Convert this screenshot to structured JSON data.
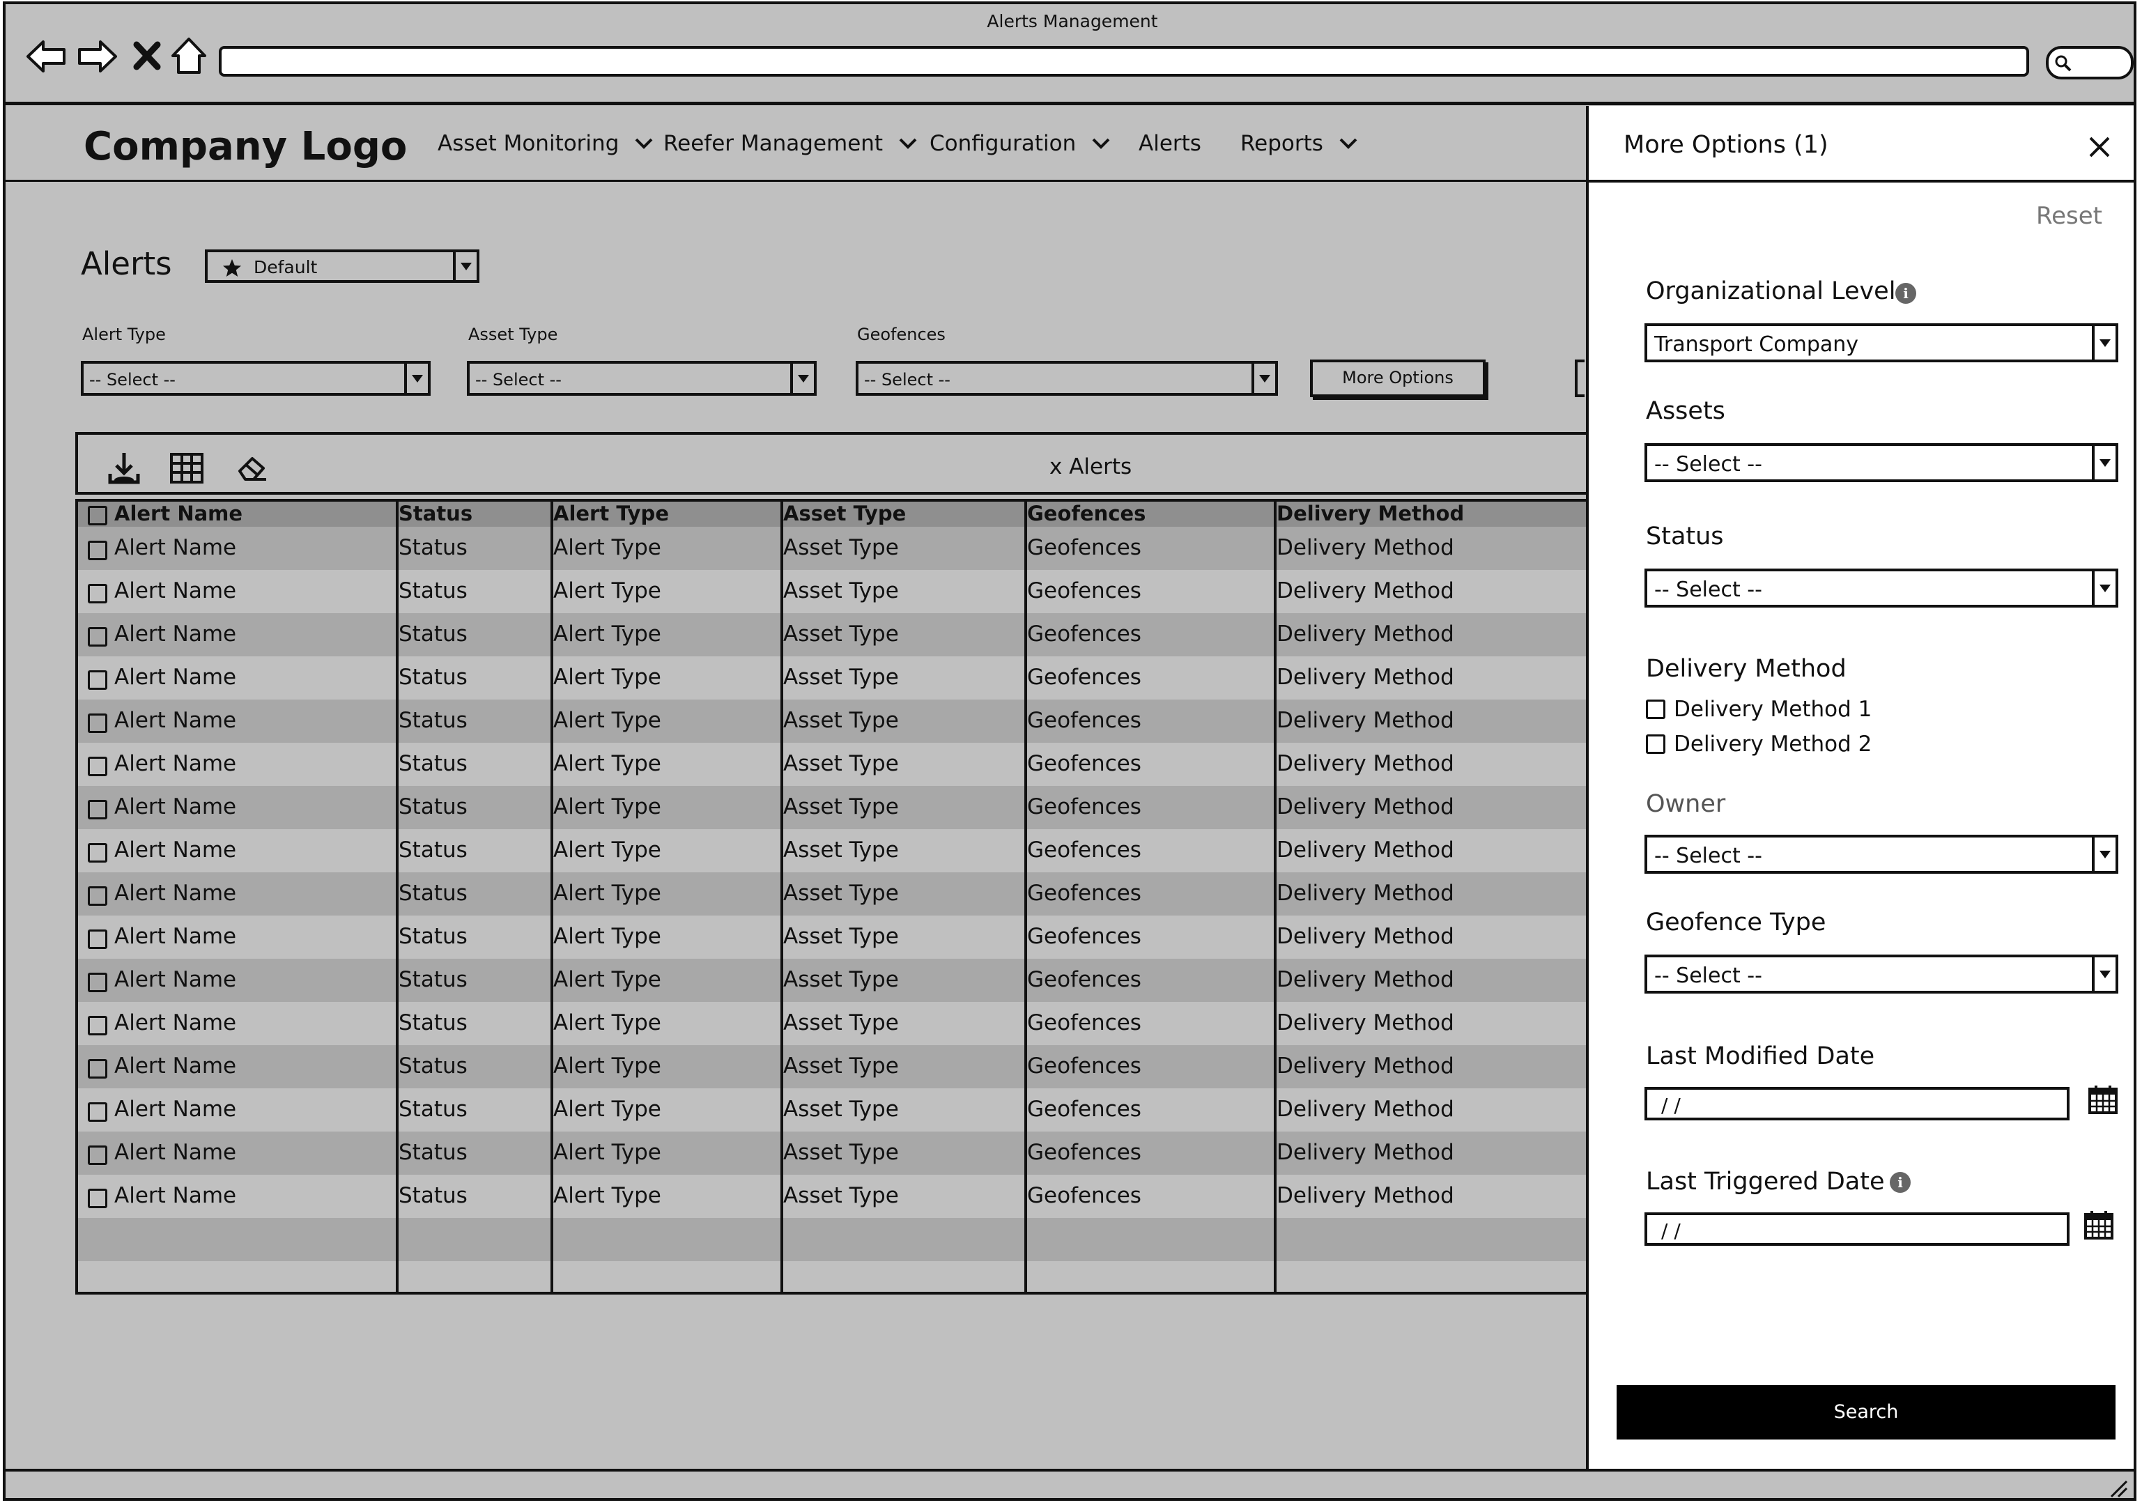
{
  "browser": {
    "title": "Alerts Management",
    "url": ""
  },
  "header": {
    "logo": "Company Logo",
    "nav": [
      {
        "label": "Asset Monitoring",
        "has_dropdown": true
      },
      {
        "label": "Reefer Management",
        "has_dropdown": true
      },
      {
        "label": "Configuration",
        "has_dropdown": true
      },
      {
        "label": "Alerts",
        "has_dropdown": false
      },
      {
        "label": "Reports",
        "has_dropdown": true
      }
    ]
  },
  "page": {
    "title": "Alerts",
    "saved_view": {
      "value": "Default",
      "icon": "star-icon"
    }
  },
  "filters": [
    {
      "label": "Alert Type",
      "value": "-- Select --"
    },
    {
      "label": "Asset Type",
      "value": "-- Select --"
    },
    {
      "label": "Geofences",
      "value": "-- Select --"
    }
  ],
  "more_options_button": "More Options",
  "toolbar": {
    "icons": [
      "download-icon",
      "grid-icon",
      "eraser-icon"
    ],
    "count_text": "x Alerts"
  },
  "table": {
    "columns": [
      "Alert Name",
      "Status",
      "Alert Type",
      "Asset Type",
      "Geofences",
      "Delivery Method"
    ],
    "rows": [
      [
        "Alert Name",
        "Status",
        "Alert Type",
        "Asset Type",
        "Geofences",
        "Delivery Method"
      ],
      [
        "Alert Name",
        "Status",
        "Alert Type",
        "Asset Type",
        "Geofences",
        "Delivery Method"
      ],
      [
        "Alert Name",
        "Status",
        "Alert Type",
        "Asset Type",
        "Geofences",
        "Delivery Method"
      ],
      [
        "Alert Name",
        "Status",
        "Alert Type",
        "Asset Type",
        "Geofences",
        "Delivery Method"
      ],
      [
        "Alert Name",
        "Status",
        "Alert Type",
        "Asset Type",
        "Geofences",
        "Delivery Method"
      ],
      [
        "Alert Name",
        "Status",
        "Alert Type",
        "Asset Type",
        "Geofences",
        "Delivery Method"
      ],
      [
        "Alert Name",
        "Status",
        "Alert Type",
        "Asset Type",
        "Geofences",
        "Delivery Method"
      ],
      [
        "Alert Name",
        "Status",
        "Alert Type",
        "Asset Type",
        "Geofences",
        "Delivery Method"
      ],
      [
        "Alert Name",
        "Status",
        "Alert Type",
        "Asset Type",
        "Geofences",
        "Delivery Method"
      ],
      [
        "Alert Name",
        "Status",
        "Alert Type",
        "Asset Type",
        "Geofences",
        "Delivery Method"
      ],
      [
        "Alert Name",
        "Status",
        "Alert Type",
        "Asset Type",
        "Geofences",
        "Delivery Method"
      ],
      [
        "Alert Name",
        "Status",
        "Alert Type",
        "Asset Type",
        "Geofences",
        "Delivery Method"
      ],
      [
        "Alert Name",
        "Status",
        "Alert Type",
        "Asset Type",
        "Geofences",
        "Delivery Method"
      ],
      [
        "Alert Name",
        "Status",
        "Alert Type",
        "Asset Type",
        "Geofences",
        "Delivery Method"
      ],
      [
        "Alert Name",
        "Status",
        "Alert Type",
        "Asset Type",
        "Geofences",
        "Delivery Method"
      ],
      [
        "Alert Name",
        "Status",
        "Alert Type",
        "Asset Type",
        "Geofences",
        "Delivery Method"
      ]
    ]
  },
  "panel": {
    "title": "More Options (1)",
    "reset": "Reset",
    "org_level": {
      "label": "Organizational Level",
      "value": "Transport Company"
    },
    "assets": {
      "label": "Assets",
      "value": "-- Select --"
    },
    "status": {
      "label": "Status",
      "value": "-- Select --"
    },
    "delivery_method": {
      "label": "Delivery Method",
      "options": [
        "Delivery Method 1",
        "Delivery Method 2"
      ]
    },
    "owner": {
      "label": "Owner",
      "value": "-- Select --"
    },
    "geofence_type": {
      "label": "Geofence Type",
      "value": "-- Select --"
    },
    "last_modified": {
      "label": "Last Modified Date",
      "value": "/ /"
    },
    "last_triggered": {
      "label": "Last Triggered Date",
      "value": "/ /"
    },
    "search": "Search"
  },
  "colors": {
    "background": "#c0c0c0",
    "panel": "#ffffff",
    "row_alt": "#a8a8a8",
    "header_row": "#8f8f8f",
    "primary_button": "#000000"
  }
}
